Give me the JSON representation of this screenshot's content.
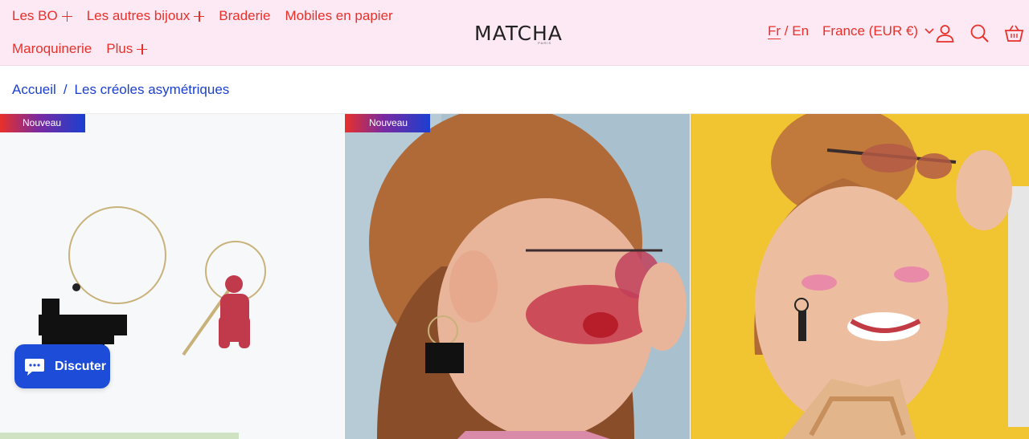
{
  "nav": {
    "row1": [
      {
        "label": "Les BO",
        "expand": true
      },
      {
        "label": "Les autres bijoux",
        "expand": true
      },
      {
        "label": "Braderie",
        "expand": false
      },
      {
        "label": "Mobiles en papier",
        "expand": false
      }
    ],
    "row2": [
      {
        "label": "Maroquinerie",
        "expand": false
      },
      {
        "label": "Plus",
        "expand": true
      }
    ]
  },
  "logo": {
    "text": "MATCHA",
    "sub": "PARIS"
  },
  "language": {
    "fr": "Fr",
    "sep": "/",
    "en": "En"
  },
  "country": {
    "label": "France (EUR €)"
  },
  "icons": [
    "account-icon",
    "search-icon",
    "cart-icon"
  ],
  "breadcrumb": {
    "home": "Accueil",
    "sep": "/",
    "current": "Les créoles asymétriques"
  },
  "products": [
    {
      "badge": "Nouveau"
    },
    {
      "badge": "Nouveau"
    },
    {
      "badge": ""
    }
  ],
  "chat": {
    "label": "Discuter"
  },
  "colors": {
    "accent": "#e8302a",
    "link": "#1a3fd0",
    "header_bg": "#fde9f4",
    "chat_bg": "#1d4cd9"
  }
}
